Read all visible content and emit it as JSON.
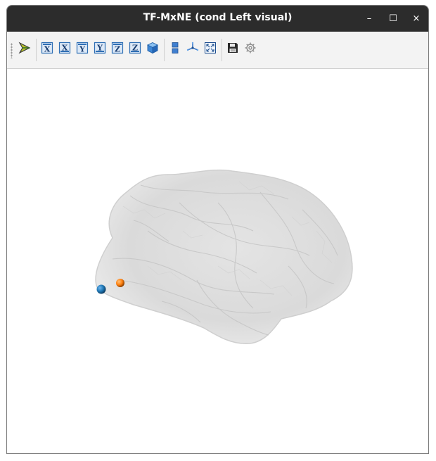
{
  "window": {
    "title": "TF-MxNE (cond Left visual)",
    "controls": {
      "minimize": "–",
      "maximize": "☐",
      "close": "×"
    }
  },
  "toolbar": {
    "items": [
      {
        "icon": "arrow-logo-icon"
      },
      {
        "icon": "view-x-icon",
        "letter": "X"
      },
      {
        "icon": "view-minus-x-icon",
        "letter": "X"
      },
      {
        "icon": "view-y-icon",
        "letter": "Y"
      },
      {
        "icon": "view-minus-y-icon",
        "letter": "Y"
      },
      {
        "icon": "view-z-icon",
        "letter": "Z"
      },
      {
        "icon": "view-minus-z-icon",
        "letter": "Z"
      },
      {
        "icon": "isometric-view-icon"
      },
      {
        "icon": "parallel-projection-icon"
      },
      {
        "icon": "axes-indicator-icon"
      },
      {
        "icon": "full-screen-icon"
      },
      {
        "icon": "save-icon"
      },
      {
        "icon": "settings-icon"
      }
    ]
  },
  "scene": {
    "surface_color": "#d8d8d8",
    "sources": [
      {
        "name": "source-1",
        "color": "#1f77b4"
      },
      {
        "name": "source-2",
        "color": "#ff7f0e"
      }
    ]
  }
}
